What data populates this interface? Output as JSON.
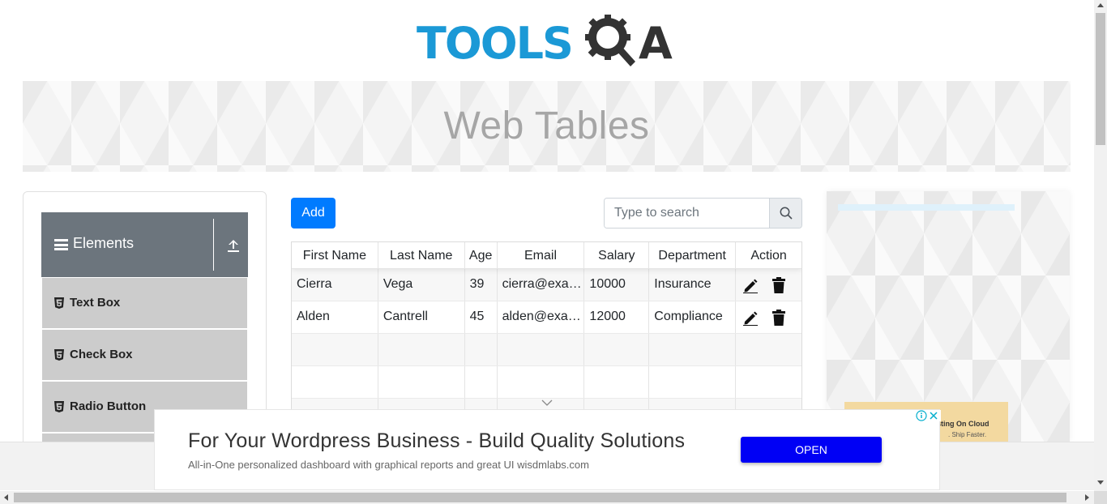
{
  "header": {
    "logo_text": "TOOLS",
    "logo_text_end": "A",
    "logo_colors": {
      "primary": "#1b99d6",
      "secondary": "#333333"
    }
  },
  "banner": {
    "title": "Web Tables"
  },
  "sidebar": {
    "group_title": "Elements",
    "items": [
      {
        "label": "Text Box",
        "icon": "html5-icon"
      },
      {
        "label": "Check Box",
        "icon": "html5-icon"
      },
      {
        "label": "Radio Button",
        "icon": "html5-icon"
      }
    ]
  },
  "toolbar": {
    "add_label": "Add",
    "search_placeholder": "Type to search",
    "search_value": ""
  },
  "table": {
    "columns": [
      "First Name",
      "Last Name",
      "Age",
      "Email",
      "Salary",
      "Department",
      "Action"
    ],
    "rows": [
      {
        "first": "Cierra",
        "last": "Vega",
        "age": "39",
        "email": "cierra@example.com",
        "salary": "10000",
        "department": "Insurance"
      },
      {
        "first": "Alden",
        "last": "Cantrell",
        "age": "45",
        "email": "alden@example.com",
        "salary": "12000",
        "department": "Compliance"
      }
    ]
  },
  "ad_right": {
    "line1": "sting On Cloud",
    "line2": ". Ship Faster."
  },
  "bottom_ad": {
    "headline": "For Your Wordpress Business - Build Quality Solutions",
    "sub": "All-in-One personalized dashboard with graphical reports and great UI wisdmlabs.com",
    "button": "OPEN"
  },
  "colors": {
    "accent": "#007bff",
    "sidebar_header": "#6c757d",
    "sidebar_item": "#cccccc",
    "ad_button": "#0000f5"
  }
}
